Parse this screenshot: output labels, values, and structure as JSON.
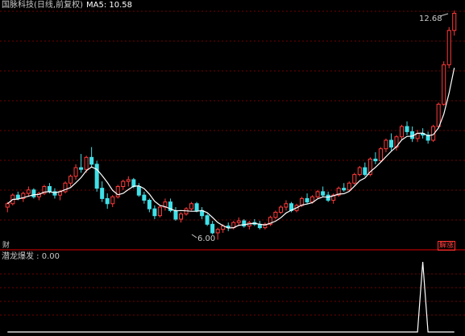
{
  "header": {
    "stock_title": "国脉科技(日线,前复权)",
    "ma_label": "MA5: 10.58"
  },
  "indicator": {
    "label": "潜龙爆发 : 0.00"
  },
  "markers": {
    "high_price": "12.68",
    "low_price": "6.00",
    "cai_badge": "财",
    "jiezhang_badge": "解涨"
  },
  "colors": {
    "up": "#ff3b3b",
    "down": "#40e0e8",
    "ma_line": "#ffffff",
    "grid": "#9a0000",
    "divider": "#b00000",
    "signal": "#ffffff"
  },
  "chart_data": [
    {
      "type": "candlestick",
      "title": "国脉科技(日线,前复权)",
      "series": [
        {
          "name": "MA5",
          "values": []
        }
      ],
      "ohlc": [
        [
          6.95,
          7.1,
          6.8,
          7.05
        ],
        [
          7.05,
          7.35,
          7.0,
          7.3
        ],
        [
          7.3,
          7.4,
          7.15,
          7.2
        ],
        [
          7.2,
          7.4,
          7.1,
          7.35
        ],
        [
          7.35,
          7.55,
          7.25,
          7.45
        ],
        [
          7.45,
          7.5,
          7.2,
          7.25
        ],
        [
          7.25,
          7.4,
          7.15,
          7.35
        ],
        [
          7.35,
          7.6,
          7.3,
          7.55
        ],
        [
          7.55,
          7.65,
          7.35,
          7.4
        ],
        [
          7.4,
          7.5,
          7.2,
          7.3
        ],
        [
          7.3,
          7.45,
          7.15,
          7.4
        ],
        [
          7.4,
          7.7,
          7.35,
          7.65
        ],
        [
          7.65,
          7.9,
          7.55,
          7.85
        ],
        [
          7.85,
          8.2,
          7.75,
          8.1
        ],
        [
          8.1,
          8.5,
          7.95,
          8.05
        ],
        [
          8.05,
          8.45,
          7.95,
          8.4
        ],
        [
          8.4,
          8.7,
          8.1,
          8.2
        ],
        [
          8.2,
          8.3,
          7.4,
          7.5
        ],
        [
          7.5,
          7.7,
          7.1,
          7.2
        ],
        [
          7.2,
          7.35,
          6.9,
          7.05
        ],
        [
          7.05,
          7.3,
          6.95,
          7.25
        ],
        [
          7.25,
          7.6,
          7.2,
          7.55
        ],
        [
          7.55,
          7.75,
          7.45,
          7.7
        ],
        [
          7.7,
          7.85,
          7.55,
          7.75
        ],
        [
          7.75,
          7.8,
          7.5,
          7.55
        ],
        [
          7.55,
          7.65,
          7.25,
          7.3
        ],
        [
          7.3,
          7.4,
          7.05,
          7.15
        ],
        [
          7.15,
          7.2,
          6.8,
          6.9
        ],
        [
          6.9,
          7.0,
          6.6,
          6.7
        ],
        [
          6.7,
          7.0,
          6.65,
          6.95
        ],
        [
          6.95,
          7.2,
          6.85,
          7.1
        ],
        [
          7.1,
          7.2,
          6.8,
          6.85
        ],
        [
          6.85,
          6.95,
          6.55,
          6.6
        ],
        [
          6.6,
          6.8,
          6.5,
          6.75
        ],
        [
          6.75,
          6.95,
          6.7,
          6.9
        ],
        [
          6.9,
          7.1,
          6.85,
          7.05
        ],
        [
          7.05,
          7.1,
          6.8,
          6.85
        ],
        [
          6.85,
          6.95,
          6.6,
          6.7
        ],
        [
          6.7,
          6.75,
          6.4,
          6.45
        ],
        [
          6.45,
          6.55,
          6.15,
          6.2
        ],
        [
          6.2,
          6.35,
          6.0,
          6.3
        ],
        [
          6.3,
          6.45,
          6.2,
          6.4
        ],
        [
          6.4,
          6.5,
          6.25,
          6.35
        ],
        [
          6.35,
          6.55,
          6.3,
          6.5
        ],
        [
          6.5,
          6.65,
          6.4,
          6.55
        ],
        [
          6.55,
          6.6,
          6.35,
          6.4
        ],
        [
          6.4,
          6.55,
          6.3,
          6.5
        ],
        [
          6.5,
          6.6,
          6.4,
          6.45
        ],
        [
          6.45,
          6.55,
          6.3,
          6.35
        ],
        [
          6.35,
          6.5,
          6.3,
          6.45
        ],
        [
          6.45,
          6.7,
          6.4,
          6.65
        ],
        [
          6.65,
          6.85,
          6.6,
          6.8
        ],
        [
          6.8,
          7.0,
          6.75,
          6.95
        ],
        [
          6.95,
          7.15,
          6.85,
          7.05
        ],
        [
          7.05,
          7.1,
          6.8,
          6.85
        ],
        [
          6.85,
          7.05,
          6.8,
          7.0
        ],
        [
          7.0,
          7.25,
          6.95,
          7.2
        ],
        [
          7.2,
          7.35,
          7.05,
          7.1
        ],
        [
          7.1,
          7.3,
          7.05,
          7.25
        ],
        [
          7.25,
          7.45,
          7.2,
          7.4
        ],
        [
          7.4,
          7.55,
          7.25,
          7.3
        ],
        [
          7.3,
          7.4,
          7.1,
          7.15
        ],
        [
          7.15,
          7.35,
          7.05,
          7.3
        ],
        [
          7.3,
          7.55,
          7.25,
          7.5
        ],
        [
          7.5,
          7.65,
          7.4,
          7.45
        ],
        [
          7.45,
          7.7,
          7.4,
          7.65
        ],
        [
          7.65,
          7.95,
          7.6,
          7.9
        ],
        [
          7.9,
          8.15,
          7.85,
          8.1
        ],
        [
          8.1,
          8.25,
          7.85,
          7.9
        ],
        [
          7.9,
          8.4,
          7.85,
          8.35
        ],
        [
          8.35,
          8.55,
          8.2,
          8.3
        ],
        [
          8.3,
          8.7,
          8.25,
          8.65
        ],
        [
          8.65,
          8.95,
          8.55,
          8.9
        ],
        [
          8.9,
          9.1,
          8.6,
          8.7
        ],
        [
          8.7,
          9.05,
          8.6,
          9.0
        ],
        [
          9.0,
          9.35,
          8.9,
          9.3
        ],
        [
          9.3,
          9.45,
          9.05,
          9.15
        ],
        [
          9.15,
          9.3,
          8.85,
          8.95
        ],
        [
          8.95,
          9.2,
          8.85,
          9.1
        ],
        [
          9.1,
          9.25,
          8.95,
          9.05
        ],
        [
          9.05,
          9.15,
          8.8,
          8.9
        ],
        [
          8.9,
          9.35,
          8.85,
          9.3
        ],
        [
          9.3,
          10.0,
          9.25,
          9.95
        ],
        [
          9.95,
          11.2,
          9.9,
          11.1
        ],
        [
          11.1,
          12.2,
          11.0,
          12.1
        ],
        [
          12.1,
          12.68,
          11.95,
          12.6
        ]
      ],
      "ylim": [
        5.8,
        12.8
      ],
      "grid": true,
      "annotations": [
        "12.68",
        "6.00",
        "解涨",
        "财"
      ]
    },
    {
      "type": "line",
      "title": "潜龙爆发",
      "series": [
        {
          "name": "潜龙爆发",
          "values": [
            0,
            0,
            0,
            0,
            0,
            0,
            0,
            0,
            0,
            0,
            0,
            0,
            0,
            0,
            0,
            0,
            0,
            0,
            0,
            0,
            0,
            0,
            0,
            0,
            0,
            0,
            0,
            0,
            0,
            0,
            0,
            0,
            0,
            0,
            0,
            0,
            0,
            0,
            0,
            0,
            0,
            0,
            0,
            0,
            0,
            0,
            0,
            0,
            0,
            0,
            0,
            0,
            0,
            0,
            0,
            0,
            0,
            0,
            0,
            0,
            0,
            0,
            0,
            0,
            0,
            0,
            0,
            0,
            0,
            0,
            0,
            0,
            0,
            0,
            0,
            0,
            0,
            0,
            0,
            1,
            0,
            0,
            0,
            0,
            0,
            0
          ]
        }
      ],
      "ylim": [
        0,
        1
      ],
      "grid": true
    }
  ]
}
